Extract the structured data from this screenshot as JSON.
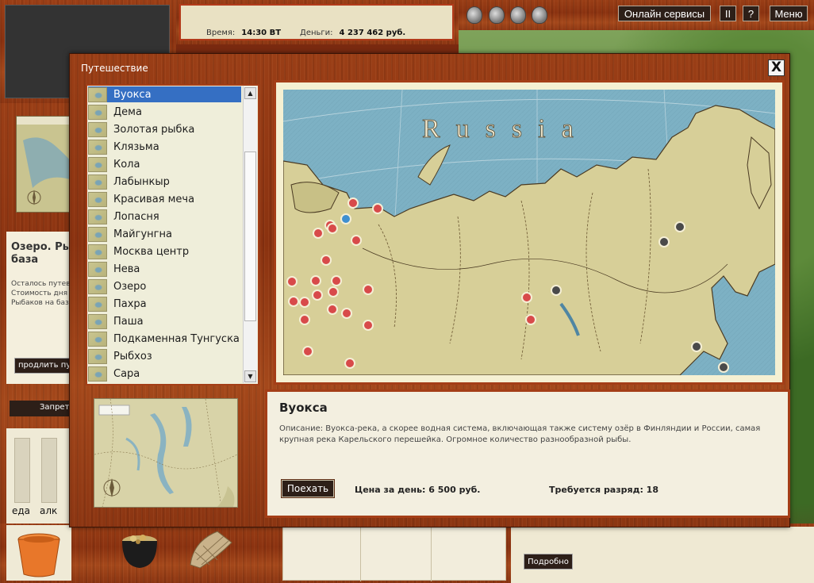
{
  "status": {
    "time_label": "Время:",
    "time_value": "14:30 ВТ",
    "money_label": "Деньги:",
    "money_value": "4 237 462 руб."
  },
  "topbar": {
    "online_services": "Онлайн сервисы",
    "pause": "II",
    "help": "?",
    "menu": "Меню"
  },
  "background": {
    "lake_title_1": "Озеро. Ры",
    "lake_title_2": "база",
    "info_line_1": "Осталось путев",
    "info_line_2": "Стоимость дня",
    "info_line_3": "Рыбаков на баз",
    "extend_button": "продлить путев",
    "forbid_button": "Запреть",
    "bar_food": "еда",
    "bar_alc": "алк",
    "details_button": "Подробно"
  },
  "travel": {
    "title": "Путешествие",
    "close": "X",
    "locations": [
      {
        "label": "Вуокса",
        "selected": true
      },
      {
        "label": "Дема"
      },
      {
        "label": "Золотая рыбка"
      },
      {
        "label": "Клязьма"
      },
      {
        "label": "Кола"
      },
      {
        "label": "Лабынкыр"
      },
      {
        "label": "Красивая меча"
      },
      {
        "label": "Лопасня"
      },
      {
        "label": "Майгунгна"
      },
      {
        "label": "Москва центр"
      },
      {
        "label": "Нева"
      },
      {
        "label": "Озеро"
      },
      {
        "label": "Пахра"
      },
      {
        "label": "Паша"
      },
      {
        "label": "Подкаменная Тунгуска"
      },
      {
        "label": "Рыбхоз"
      },
      {
        "label": "Сара"
      }
    ],
    "map_label": "Russia",
    "colors": {
      "sea": "#7db1c4",
      "land": "#d7cf98",
      "marker_available": "#d84a4a",
      "marker_locked": "#4a4a4a",
      "marker_selected": "#3f8fd0",
      "accent_frame": "#a43e17"
    },
    "info": {
      "name": "Вуокса",
      "description": "Описание: Вуокса-река, а скорее водная система, включающая также систему озёр в Финляндии и России, самая крупная река Карельского перешейка. Огромное количество разнообразной рыбы.",
      "go_button": "Поехать",
      "price": "Цена за день: 6 500 руб.",
      "rank": "Требуется разряд: 18"
    }
  }
}
